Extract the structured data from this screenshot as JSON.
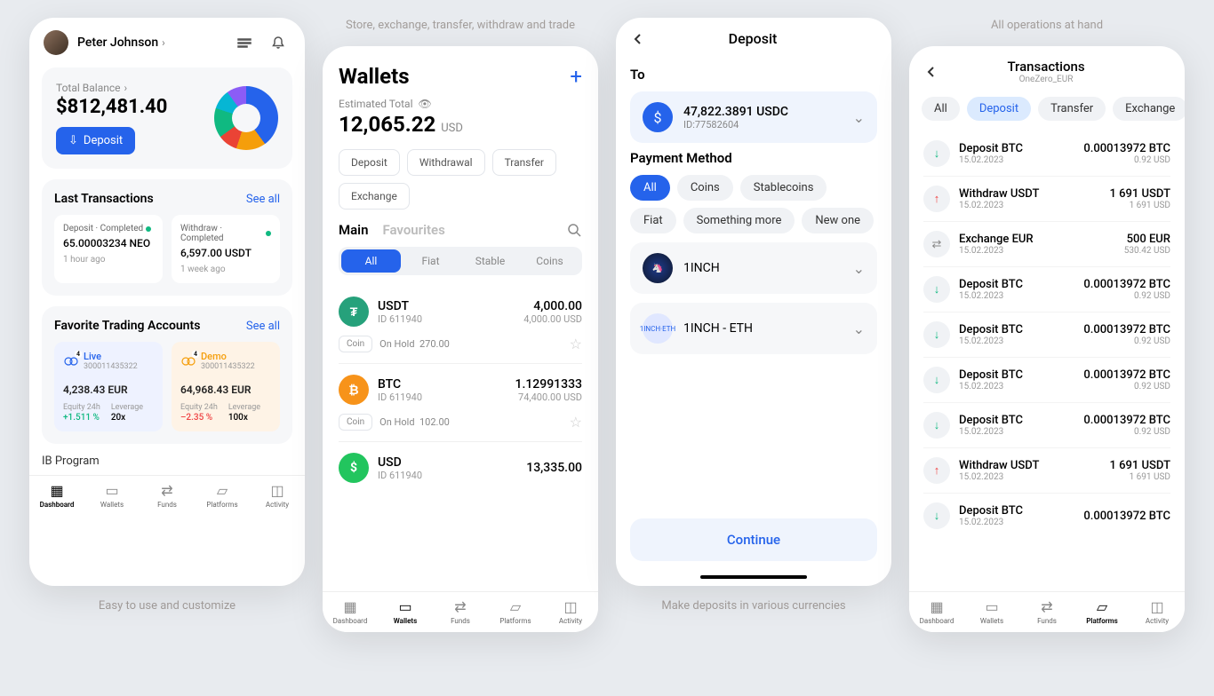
{
  "captions": {
    "s1_bot": "Easy to use and customize",
    "s2_top": "Store, exchange, transfer, withdraw and trade",
    "s3_bot": "Make deposits in various currencies",
    "s4_top": "All operations at hand"
  },
  "nav": {
    "dashboard": "Dashboard",
    "wallets": "Wallets",
    "funds": "Funds",
    "platforms": "Platforms",
    "activity": "Activity"
  },
  "s1": {
    "user": "Peter Johnson",
    "balance_label": "Total Balance",
    "balance": "$812,481.40",
    "deposit_btn": "Deposit",
    "last_tx": "Last Transactions",
    "see_all": "See all",
    "tx": [
      {
        "status": "Deposit · Completed",
        "amt": "65.00003234 NEO",
        "time": "1 hour ago"
      },
      {
        "status": "Withdraw · Completed",
        "amt": "6,597.00 USDT",
        "time": "1 week ago"
      }
    ],
    "fav": "Favorite Trading Accounts",
    "accounts": [
      {
        "type": "Live",
        "badge": "4",
        "id": "300011435322",
        "bal": "4,238.43 EUR",
        "eq_lbl": "Equity 24h",
        "eq": "+1.511 %",
        "lv_lbl": "Leverage",
        "lv": "20x"
      },
      {
        "type": "Demo",
        "badge": "4",
        "id": "300011435322",
        "bal": "64,968.43 EUR",
        "eq_lbl": "Equity 24h",
        "eq": "–2.35 %",
        "lv_lbl": "Leverage",
        "lv": "100x"
      }
    ],
    "ib": "IB Program"
  },
  "s2": {
    "title": "Wallets",
    "est_lbl": "Estimated Total",
    "est_amt": "12,065.22",
    "est_cur": "USD",
    "chips": [
      "Deposit",
      "Withdrawal",
      "Transfer",
      "Exchange"
    ],
    "tab_main": "Main",
    "tab_fav": "Favourites",
    "seg": [
      "All",
      "Fiat",
      "Stable",
      "Coins"
    ],
    "coin_tag": "Coin",
    "hold_lbl": "On Hold",
    "wallets": [
      {
        "sym": "USDT",
        "id": "ID 611940",
        "amt": "4,000.00",
        "usd": "4,000.00 USD",
        "hold": "270.00",
        "cls": "usdt",
        "glyph": "₮"
      },
      {
        "sym": "BTC",
        "id": "ID 611940",
        "amt": "1.12991333",
        "usd": "74,400.00 USD",
        "hold": "102.00",
        "cls": "btc",
        "glyph": "₿"
      },
      {
        "sym": "USD",
        "id": "ID 611940",
        "amt": "13,335.00",
        "usd": "",
        "hold": "",
        "cls": "usd",
        "glyph": "$"
      }
    ]
  },
  "s3": {
    "title": "Deposit",
    "to": "To",
    "dest_amt": "47,822.3891 USDC",
    "dest_id": "ID:77582604",
    "pm": "Payment Method",
    "pills": [
      "All",
      "Coins",
      "Stablecoins",
      "Fiat",
      "Something more",
      "New one"
    ],
    "sel1": "1INCH",
    "sel2": "1INCH - ETH",
    "cont": "Continue"
  },
  "s4": {
    "title": "Transactions",
    "sub": "OneZero_EUR",
    "filters": [
      "All",
      "Deposit",
      "Transfer",
      "Exchange"
    ],
    "items": [
      {
        "ico": "dep",
        "glyph": "↓",
        "name": "Deposit BTC",
        "date": "15.02.2023",
        "amt": "0.00013972 BTC",
        "usd": "0.92 USD"
      },
      {
        "ico": "wdr",
        "glyph": "↑",
        "name": "Withdraw USDT",
        "date": "15.02.2023",
        "amt": "1 691 USDT",
        "usd": "1 691 USD"
      },
      {
        "ico": "exc",
        "glyph": "⇄",
        "name": "Exchange EUR",
        "date": "15.02.2023",
        "amt": "500 EUR",
        "usd": "530.42 USD"
      },
      {
        "ico": "dep",
        "glyph": "↓",
        "name": "Deposit BTC",
        "date": "15.02.2023",
        "amt": "0.00013972 BTC",
        "usd": "0.92 USD"
      },
      {
        "ico": "dep",
        "glyph": "↓",
        "name": "Deposit BTC",
        "date": "15.02.2023",
        "amt": "0.00013972 BTC",
        "usd": "0.92 USD"
      },
      {
        "ico": "dep",
        "glyph": "↓",
        "name": "Deposit BTC",
        "date": "15.02.2023",
        "amt": "0.00013972 BTC",
        "usd": "0.92 USD"
      },
      {
        "ico": "dep",
        "glyph": "↓",
        "name": "Deposit BTC",
        "date": "15.02.2023",
        "amt": "0.00013972 BTC",
        "usd": "0.92 USD"
      },
      {
        "ico": "wdr",
        "glyph": "↑",
        "name": "Withdraw USDT",
        "date": "15.02.2023",
        "amt": "1 691 USDT",
        "usd": "1 691 USD"
      },
      {
        "ico": "dep",
        "glyph": "↓",
        "name": "Deposit BTC",
        "date": "15.02.2023",
        "amt": "0.00013972 BTC",
        "usd": ""
      }
    ]
  }
}
